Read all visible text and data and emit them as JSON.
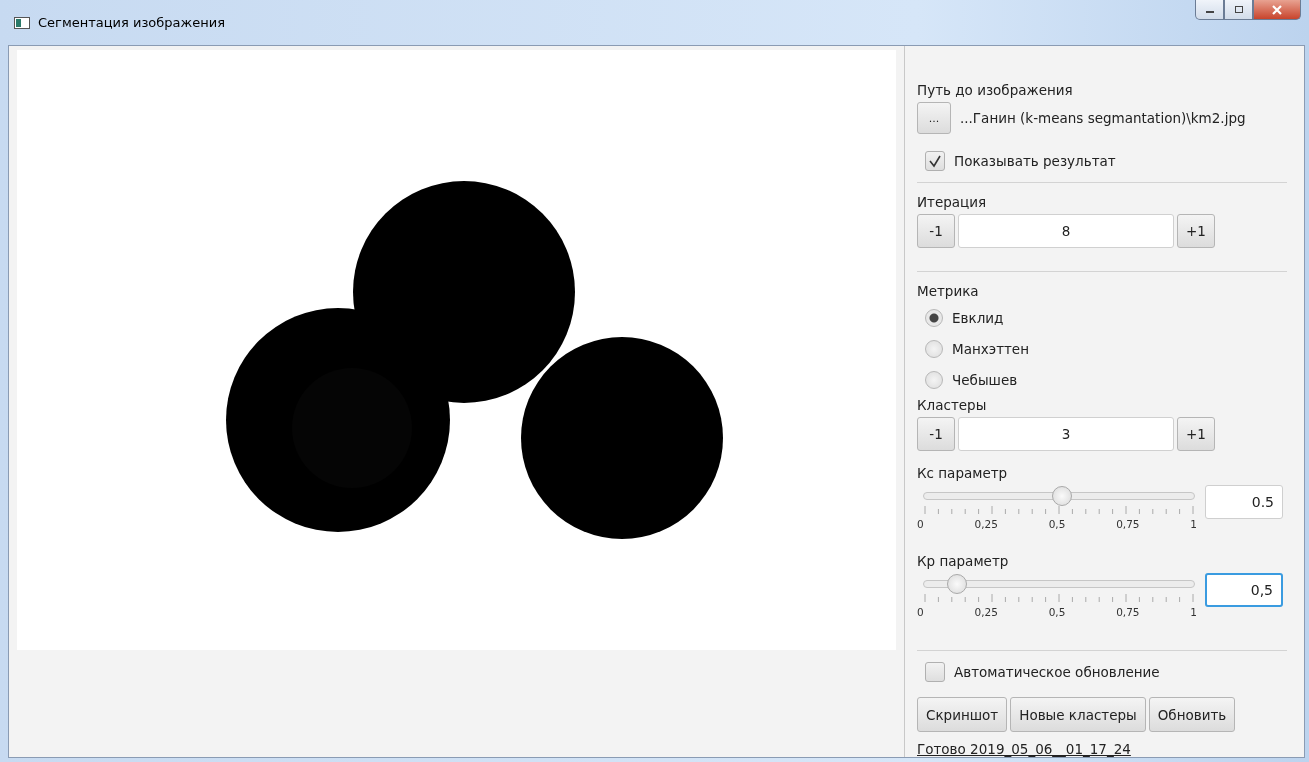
{
  "window": {
    "title": "Сегментация изображения"
  },
  "panel": {
    "path": {
      "label": "Путь до изображения",
      "button": "...",
      "value": "...Ганин (k-means segmantation)\\km2.jpg"
    },
    "show_result": {
      "label": "Показывать результат",
      "checked": true
    },
    "iteration": {
      "label": "Итерация",
      "decrement": "-1",
      "value": "8",
      "increment": "+1"
    },
    "metric": {
      "label": "Метрика",
      "options": [
        {
          "label": "Евклид",
          "selected": true
        },
        {
          "label": "Манхэттен",
          "selected": false
        },
        {
          "label": "Чебышев",
          "selected": false
        }
      ]
    },
    "clusters": {
      "label": "Кластеры",
      "decrement": "-1",
      "value": "3",
      "increment": "+1"
    },
    "sliders": [
      {
        "label": "Кс параметр",
        "level": 0.49,
        "ticks": [
          "0",
          "0,25",
          "0,5",
          "0,75",
          "1"
        ],
        "value": "0.5",
        "focused": false
      },
      {
        "label": "Кр параметр",
        "level": 0.12,
        "ticks": [
          "0",
          "0,25",
          "0,5",
          "0,75",
          "1"
        ],
        "value": "0,5",
        "focused": true
      }
    ],
    "auto_update": {
      "label": "Автоматическое обновление",
      "checked": false
    },
    "buttons": [
      "Скриншот",
      "Новые кластеры",
      "Обновить"
    ],
    "status": "Готово 2019_05_06__01_17_24"
  }
}
